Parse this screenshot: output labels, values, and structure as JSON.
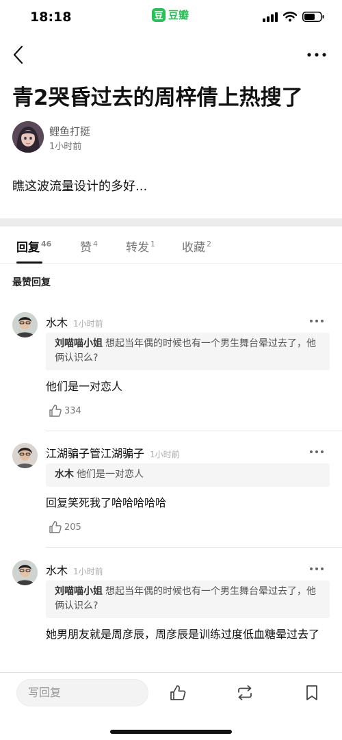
{
  "status": {
    "time": "18:18",
    "app_badge": "豆",
    "app_name": "豆瓣"
  },
  "post": {
    "title": "青2哭昏过去的周梓倩上热搜了",
    "author": {
      "name": "鲤鱼打挺",
      "time": "1小时前"
    },
    "body": "瞧这波流量设计的多好..."
  },
  "tabs": [
    {
      "label": "回复",
      "count": "46"
    },
    {
      "label": "赞",
      "count": "4"
    },
    {
      "label": "转发",
      "count": "1"
    },
    {
      "label": "收藏",
      "count": "2"
    }
  ],
  "section_label": "最赞回复",
  "comments": [
    {
      "name": "水木",
      "time": "1小时前",
      "quote_author": "刘喵喵小姐",
      "quote_text": "想起当年偶的时候也有一个男生舞台晕过去了，他俩认识么?",
      "text": "他们是一对恋人",
      "likes": "334"
    },
    {
      "name": "江湖骗子管江湖骗子",
      "time": "1小时前",
      "quote_author": "水木",
      "quote_text": "他们是一对恋人",
      "text": "回复笑死我了哈哈哈哈哈",
      "likes": "205"
    },
    {
      "name": "水木",
      "time": "1小时前",
      "quote_author": "刘喵喵小姐",
      "quote_text": "想起当年偶的时候也有一个男生舞台晕过去了，他俩认识么?",
      "text": "她男朋友就是周彦辰，周彦辰是训练过度低血糖晕过去了"
    }
  ],
  "bottom_bar": {
    "reply_placeholder": "写回复"
  },
  "colors": {
    "brand_green": "#2fbd5a",
    "band_gray": "#ececec",
    "quote_bg": "#f5f5f5"
  },
  "icons": [
    "back-arrow-icon",
    "more-icon",
    "thumbs-up-icon",
    "repost-icon",
    "bookmark-icon",
    "signal-icon",
    "wifi-icon",
    "battery-icon"
  ]
}
